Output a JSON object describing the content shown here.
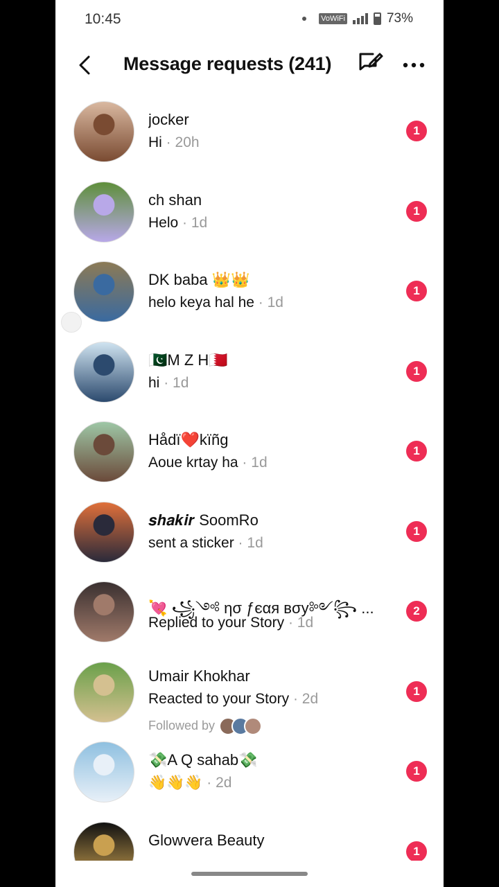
{
  "status_bar": {
    "time": "10:45",
    "network_label": "VoWiFi",
    "battery": "73%"
  },
  "header": {
    "title": "Message requests (241)"
  },
  "requests": [
    {
      "name": "jocker",
      "message": "Hi",
      "time": "20h",
      "unread": "1",
      "avatar_color": "#d9b8a0",
      "avatar_accent": "#7a4b32"
    },
    {
      "name": "ch shan",
      "message": "Helo",
      "time": "1d",
      "unread": "1",
      "avatar_color": "#5e8f3a",
      "avatar_accent": "#b8a8e8"
    },
    {
      "name": "DK baba 👑👑",
      "message": "helo keya hal he",
      "time": "1d",
      "unread": "1",
      "avatar_color": "#8c7a55",
      "avatar_accent": "#3a6aa0"
    },
    {
      "name": "🇵🇰M Z H🇧🇭",
      "message": "hi",
      "time": "1d",
      "unread": "1",
      "avatar_color": "#cfe3f0",
      "avatar_accent": "#2c4a6e"
    },
    {
      "name": "Hådï❤️kïñg",
      "message": "Aoue krtay ha",
      "time": "1d",
      "unread": "1",
      "avatar_color": "#9ec7a6",
      "avatar_accent": "#6b4a3a"
    },
    {
      "name": "𝒔𝒉𝒂𝒌𝒊𝒓 SoomRo",
      "message": "sent a sticker",
      "time": "1d",
      "unread": "1",
      "avatar_color": "#e0703a",
      "avatar_accent": "#2a2a3a"
    },
    {
      "name": "💘 ꧁༺ ησ ƒєαя вσу༻꧂ ...",
      "message": "Replied to your Story",
      "time": "1d",
      "unread": "2",
      "avatar_color": "#3a3030",
      "avatar_accent": "#a07a6a"
    },
    {
      "name": "Umair Khokhar",
      "message": "Reacted to your Story",
      "time": "2d",
      "unread": "1",
      "followed_by": "Followed by",
      "avatar_color": "#6aa04a",
      "avatar_accent": "#d4c090"
    },
    {
      "name": "💸A Q sahab💸",
      "message": "👋👋👋",
      "time": "2d",
      "unread": "1",
      "avatar_color": "#8fc0e0",
      "avatar_accent": "#e8f0f8"
    },
    {
      "name": "Glowvera Beauty",
      "message": "",
      "time": "",
      "unread": "1",
      "avatar_color": "#111111",
      "avatar_accent": "#c9a050"
    }
  ]
}
